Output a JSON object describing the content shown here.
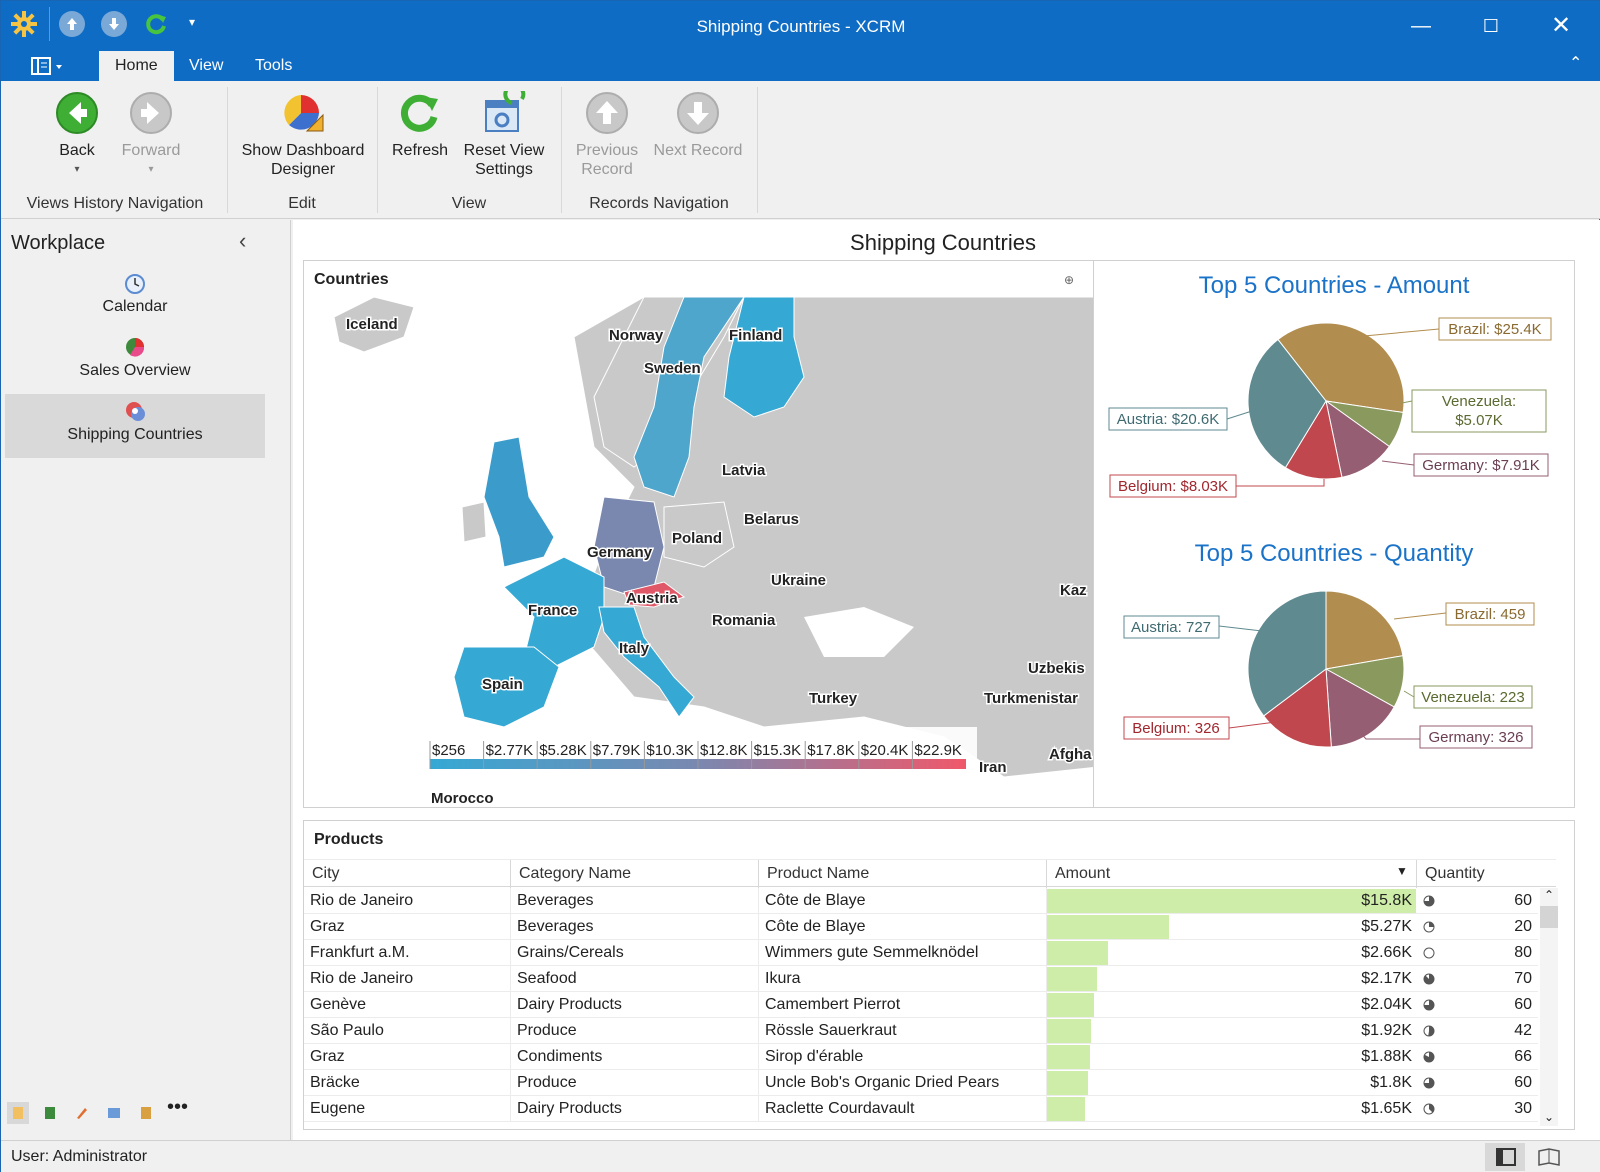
{
  "window": {
    "title": "Shipping Countries - XCRM"
  },
  "ribbon": {
    "tabs": [
      "Home",
      "View",
      "Tools"
    ],
    "buttons": {
      "back": "Back",
      "forward": "Forward",
      "designer": "Show Dashboard Designer",
      "refresh": "Refresh",
      "reset": "Reset View Settings",
      "previous": "Previous Record",
      "next": "Next Record"
    },
    "groups": {
      "history": "Views History Navigation",
      "edit": "Edit",
      "view": "View",
      "records": "Records Navigation"
    }
  },
  "sidebar": {
    "title": "Workplace",
    "items": [
      "Calendar",
      "Sales Overview",
      "Shipping Countries"
    ]
  },
  "dashboard": {
    "title": "Shipping Countries"
  },
  "map": {
    "title": "Countries",
    "legend": [
      "$256",
      "$2.77K",
      "$5.28K",
      "$7.79K",
      "$10.3K",
      "$12.8K",
      "$15.3K",
      "$17.8K",
      "$20.4K",
      "$22.9K"
    ],
    "labels": [
      "Iceland",
      "Norway",
      "Finland",
      "Sweden",
      "Latvia",
      "Belarus",
      "Poland",
      "Germany",
      "Ukraine",
      "Kaz",
      "Austria",
      "France",
      "Romania",
      "Italy",
      "Uzbekis",
      "Spain",
      "Turkmenistar",
      "Turkey",
      "Afgha",
      "Iran",
      "Morocco"
    ]
  },
  "pie_amount": {
    "title": "Top 5 Countries - Amount",
    "labels": {
      "brazil": "Brazil: $25.4K",
      "austria": "Austria: $20.6K",
      "venezuela1": "Venezuela:",
      "venezuela2": "$5.07K",
      "germany": "Germany: $7.91K",
      "belgium": "Belgium: $8.03K"
    }
  },
  "pie_qty": {
    "title": "Top 5 Countries - Quantity",
    "labels": {
      "austria": "Austria: 727",
      "brazil": "Brazil: 459",
      "venezuela": "Venezuela: 223",
      "belgium": "Belgium: 326",
      "germany": "Germany: 326"
    }
  },
  "chart_data": [
    {
      "type": "pie",
      "title": "Top 5 Countries - Amount",
      "categories": [
        "Brazil",
        "Venezuela",
        "Germany",
        "Belgium",
        "Austria"
      ],
      "values": [
        25.4,
        5.07,
        7.91,
        8.03,
        20.6
      ],
      "colors": [
        "#b18d4f",
        "#8a9a5f",
        "#955e72",
        "#c0474e",
        "#5e8a90"
      ]
    },
    {
      "type": "pie",
      "title": "Top 5 Countries - Quantity",
      "categories": [
        "Brazil",
        "Venezuela",
        "Germany",
        "Belgium",
        "Austria"
      ],
      "values": [
        459,
        223,
        326,
        326,
        727
      ],
      "colors": [
        "#b18d4f",
        "#8a9a5f",
        "#955e72",
        "#c0474e",
        "#5e8a90"
      ]
    }
  ],
  "products": {
    "title": "Products",
    "columns": [
      "City",
      "Category Name",
      "Product Name",
      "Amount",
      "Quantity"
    ],
    "rows": [
      {
        "city": "Rio de Janeiro",
        "category": "Beverages",
        "product": "Côte de Blaye",
        "amount": "$15.8K",
        "value": 15.8,
        "qty": "60"
      },
      {
        "city": "Graz",
        "category": "Beverages",
        "product": "Côte de Blaye",
        "amount": "$5.27K",
        "value": 5.27,
        "qty": "20"
      },
      {
        "city": "Frankfurt a.M.",
        "category": "Grains/Cereals",
        "product": "Wimmers gute Semmelknödel",
        "amount": "$2.66K",
        "value": 2.66,
        "qty": "80"
      },
      {
        "city": "Rio de Janeiro",
        "category": "Seafood",
        "product": "Ikura",
        "amount": "$2.17K",
        "value": 2.17,
        "qty": "70"
      },
      {
        "city": "Genève",
        "category": "Dairy Products",
        "product": "Camembert Pierrot",
        "amount": "$2.04K",
        "value": 2.04,
        "qty": "60"
      },
      {
        "city": "São Paulo",
        "category": "Produce",
        "product": "Rössle Sauerkraut",
        "amount": "$1.92K",
        "value": 1.92,
        "qty": "42"
      },
      {
        "city": "Graz",
        "category": "Condiments",
        "product": "Sirop d'érable",
        "amount": "$1.88K",
        "value": 1.88,
        "qty": "66"
      },
      {
        "city": "Bräcke",
        "category": "Produce",
        "product": "Uncle Bob's Organic Dried Pears",
        "amount": "$1.8K",
        "value": 1.8,
        "qty": "60"
      },
      {
        "city": "Eugene",
        "category": "Dairy Products",
        "product": "Raclette Courdavault",
        "amount": "$1.65K",
        "value": 1.65,
        "qty": "30"
      }
    ]
  },
  "status": {
    "user": "User: Administrator"
  }
}
